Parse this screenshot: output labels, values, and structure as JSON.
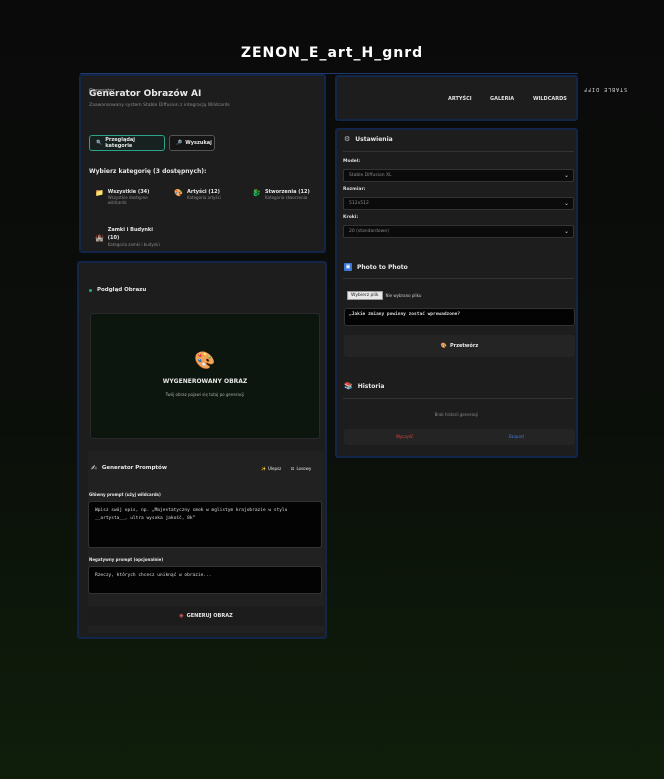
{
  "site": {
    "title": "ZENON_E_art_H_gnrd",
    "stable_label": "STABLE DIFF"
  },
  "generator": {
    "overlay": "Generator",
    "title": "Generator Obrazów AI",
    "subtitle": "Zaawansowany system Stable Diffusion z integracją Wildcards",
    "browse_label": "Przeglądaj kategorie",
    "search_label": "Wyszukaj",
    "choose_title": "Wybierz kategorię (3 dostępnych):",
    "categories": [
      {
        "name": "Wszystkie (34)",
        "desc": "Wszystkie dostępne wildcards",
        "icon": "📁"
      },
      {
        "name": "Artyści (12)",
        "desc": "Kategoria artyści",
        "icon": "🎨"
      },
      {
        "name": "Stworzenia (12)",
        "desc": "Kategoria stworzenia",
        "icon": "🐉"
      },
      {
        "name": "Zamki i Budynki (10)",
        "desc": "Kategoria zamki i budynki",
        "icon": "🏰"
      }
    ]
  },
  "nav": {
    "items": [
      "ARTYŚCI",
      "GALERIA",
      "WILDCARDS"
    ]
  },
  "settings": {
    "title": "Ustawienia",
    "model_label": "Model:",
    "model_value": "Stable Diffusion XL",
    "size_label": "Rozmiar:",
    "size_value": "512x512",
    "steps_label": "Kroki:",
    "steps_value": "20 (standardowe)"
  },
  "photo": {
    "title": "Photo to Photo",
    "file_button": "Wybierz plik",
    "file_status": "Nie wybrano pliku",
    "prompt_value": "„Jakie zmiany powinny zostać wprowadzone?",
    "process_label": "Przetwórz"
  },
  "history": {
    "title": "Historia",
    "empty": "Brak historii generacji",
    "clear_label": "Wyczyść",
    "export_label": "Eksport"
  },
  "preview": {
    "title": "Podgląd Obrazu",
    "placeholder_title": "WYGENEROWANY OBRAZ",
    "placeholder_sub": "Twój obraz pojawi się tutaj po generacji"
  },
  "prompt_gen": {
    "title": "Generator Promptów",
    "improve_label": "Ulepsz",
    "random_label": "Losowy",
    "main_label": "Główny prompt (użyj wildcards)",
    "main_value": "Wpisz swój opis, np. „Majestatyczny smok w mglistym krajobrazie w stylu __artysta__, ultra wysoka jakość, 8k”",
    "neg_label": "Negatywny prompt (opcjonalnie)",
    "neg_value": "Rzeczy, których chcesz uniknąć w obrazie...",
    "generate_label": "GENERUJ OBRAZ"
  },
  "colors": {
    "accent": "#2aa58b",
    "panel_border": "#14254a",
    "danger": "#e0443a",
    "link": "#4a7bd0"
  }
}
